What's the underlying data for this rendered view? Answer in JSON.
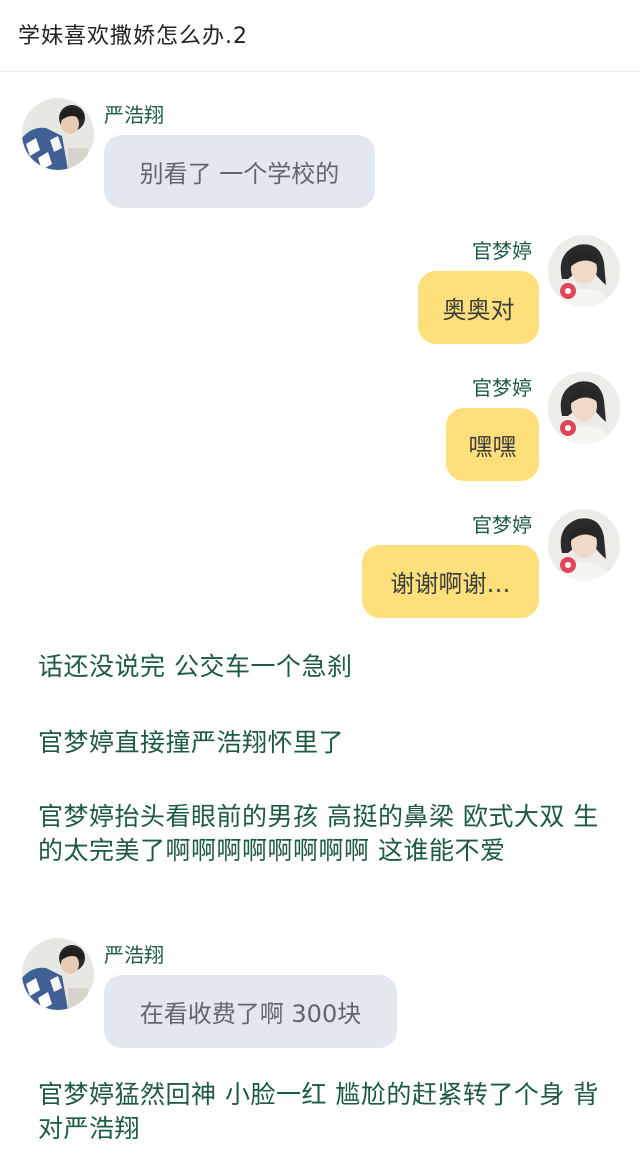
{
  "header": {
    "title": "学妹喜欢撒娇怎么办.2"
  },
  "chat": {
    "m1": {
      "name": "严浩翔",
      "text": "别看了 一个学校的",
      "avatar": "boy-avatar-icon"
    },
    "m2": {
      "name": "官梦婷",
      "text": "奥奥对",
      "avatar": "girl-avatar-icon"
    },
    "m3": {
      "name": "官梦婷",
      "text": "嘿嘿",
      "avatar": "girl-avatar-icon"
    },
    "m4": {
      "name": "官梦婷",
      "text": "谢谢啊谢…",
      "avatar": "girl-avatar-icon"
    },
    "m5": {
      "name": "严浩翔",
      "text": "在看收费了啊 300块",
      "avatar": "boy-avatar-icon"
    }
  },
  "narration": {
    "p1": "话还没说完 公交车一个急刹",
    "p2": "官梦婷直接撞严浩翔怀里了",
    "p3": "官梦婷抬头看眼前的男孩 高挺的鼻梁 欧式大双 生的太完美了啊啊啊啊啊啊啊啊 这谁能不爱",
    "p4": "官梦婷猛然回神 小脸一红 尴尬的赶紧转了个身 背对严浩翔"
  },
  "colors": {
    "narration_text": "#1d5a40",
    "left_bubble": "#e3e8ef",
    "right_bubble": "#fde07c"
  }
}
